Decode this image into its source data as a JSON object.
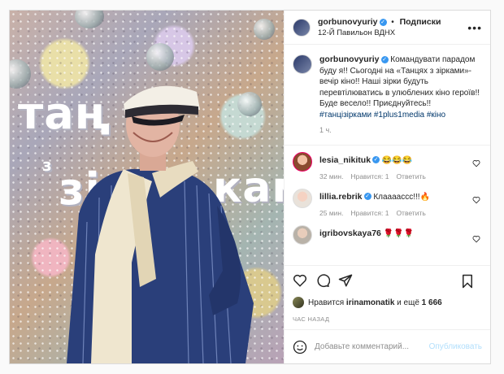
{
  "post": {
    "username": "gorbunovyuriy",
    "follow_label": "Подписки",
    "location": "12-Й Павильон ВДНХ",
    "sign_text": "танці з зірками",
    "caption": {
      "username": "gorbunovyuriy",
      "text": "Командувати парадом буду я!! Сьогодні на «Танцях з зірками»-вечір кіно!! Наші зірки будуть перевтілюватись в улюблених кіно героїв!!Буде весело!! Приєднуйтесь!!",
      "hashtags": "#танцізірками #1plus1media #кіно",
      "time": "1 ч."
    },
    "comments": [
      {
        "username": "lesia_nikituk",
        "text": "😂😂😂",
        "time": "32 мин.",
        "likes": "Нравится: 1",
        "reply": "Ответить"
      },
      {
        "username": "lillia.rebrik",
        "text": "Клаааассс!!!🔥",
        "time": "25 мин.",
        "likes": "Нравится: 1",
        "reply": "Ответить"
      },
      {
        "username": "igribovskaya76",
        "text": "🌹🌹🌹"
      }
    ],
    "likes_prefix": "Нравится",
    "likes_user": "irinamonatik",
    "likes_suffix": "и ещё",
    "likes_count": "1 666",
    "ago": "ЧАС НАЗАД",
    "comment_placeholder": "Добавьте комментарий...",
    "publish_label": "Опубликовать"
  },
  "icons": [
    "more-icon",
    "verified-icon",
    "heart-icon",
    "comment-icon",
    "share-icon",
    "bookmark-icon",
    "emoji-icon"
  ],
  "colors": {
    "link": "#00376b",
    "verified": "#3897f0",
    "publish": "#b2dffc",
    "muted": "#8e8e8e"
  }
}
